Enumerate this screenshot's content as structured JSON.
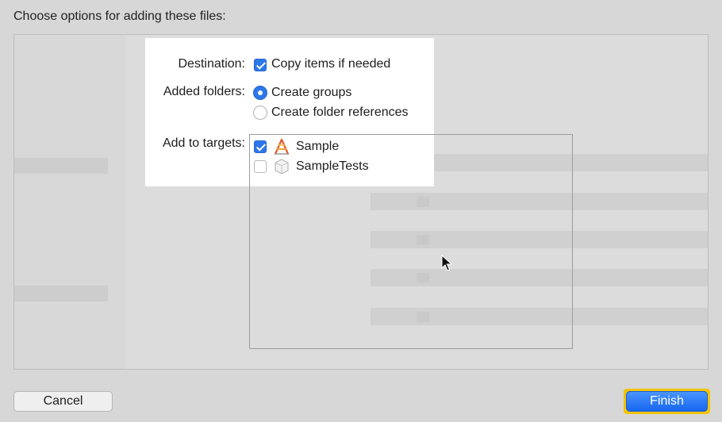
{
  "dialog": {
    "title": "Choose options for adding these files:"
  },
  "options": {
    "destination_label": "Destination:",
    "copy_items_label": "Copy items if needed",
    "copy_items_checked": true,
    "added_folders_label": "Added folders:",
    "create_groups_label": "Create groups",
    "create_groups_selected": true,
    "create_folder_refs_label": "Create folder references",
    "create_folder_refs_selected": false,
    "add_to_targets_label": "Add to targets:"
  },
  "targets": [
    {
      "name": "Sample",
      "checked": true,
      "icon": "app-target-icon"
    },
    {
      "name": "SampleTests",
      "checked": false,
      "icon": "test-bundle-icon"
    }
  ],
  "buttons": {
    "cancel": "Cancel",
    "finish": "Finish"
  },
  "colors": {
    "accent": "#2d78e8",
    "focus_ring": "#f2c300"
  }
}
